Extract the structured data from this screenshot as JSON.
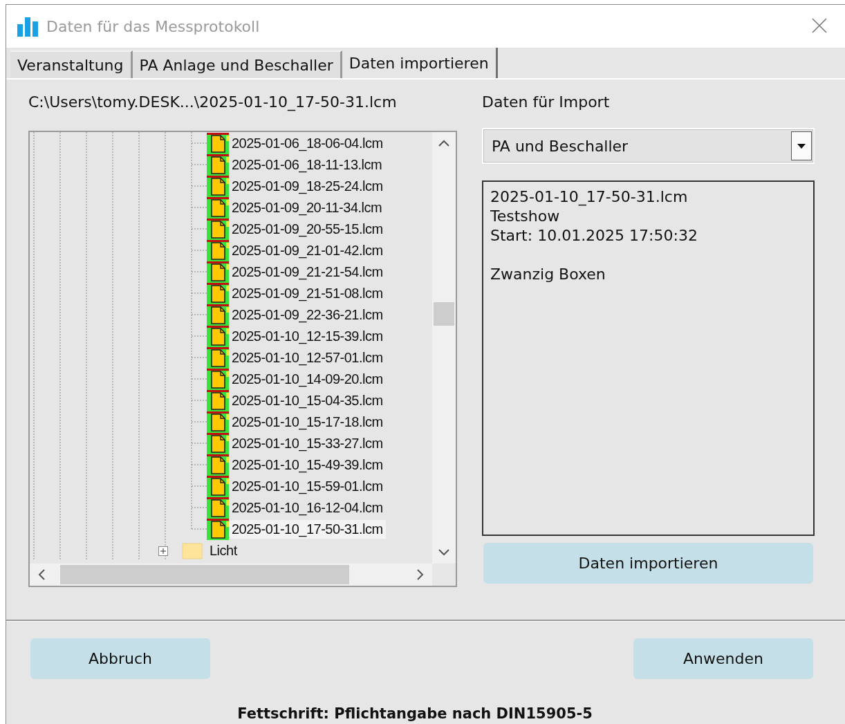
{
  "window": {
    "title": "Daten für das Messprotokoll"
  },
  "tabs": [
    {
      "label": "Veranstaltung",
      "selected": false
    },
    {
      "label": "PA Anlage und Beschaller",
      "selected": false
    },
    {
      "label": "Daten importieren",
      "selected": true
    }
  ],
  "path": "C:\\Users\\tomy.DESK...\\2025-01-10_17-50-31.lcm",
  "tree": {
    "files": [
      {
        "name": "2025-01-06_18-06-04.lcm",
        "selected": false
      },
      {
        "name": "2025-01-06_18-11-13.lcm",
        "selected": false
      },
      {
        "name": "2025-01-09_18-25-24.lcm",
        "selected": false
      },
      {
        "name": "2025-01-09_20-11-34.lcm",
        "selected": false
      },
      {
        "name": "2025-01-09_20-55-15.lcm",
        "selected": false
      },
      {
        "name": "2025-01-09_21-01-42.lcm",
        "selected": false
      },
      {
        "name": "2025-01-09_21-21-54.lcm",
        "selected": false
      },
      {
        "name": "2025-01-09_21-51-08.lcm",
        "selected": false
      },
      {
        "name": "2025-01-09_22-36-21.lcm",
        "selected": false
      },
      {
        "name": "2025-01-10_12-15-39.lcm",
        "selected": false
      },
      {
        "name": "2025-01-10_12-57-01.lcm",
        "selected": false
      },
      {
        "name": "2025-01-10_14-09-20.lcm",
        "selected": false
      },
      {
        "name": "2025-01-10_15-04-35.lcm",
        "selected": false
      },
      {
        "name": "2025-01-10_15-17-18.lcm",
        "selected": false
      },
      {
        "name": "2025-01-10_15-33-27.lcm",
        "selected": false
      },
      {
        "name": "2025-01-10_15-49-39.lcm",
        "selected": false
      },
      {
        "name": "2025-01-10_15-59-01.lcm",
        "selected": false
      },
      {
        "name": "2025-01-10_16-12-04.lcm",
        "selected": false
      },
      {
        "name": "2025-01-10_17-50-31.lcm",
        "selected": true
      }
    ],
    "folder": {
      "name": "Licht",
      "expanded": false
    }
  },
  "import": {
    "label": "Daten für Import",
    "dropdown": "PA und Beschaller",
    "info": [
      [
        "2025-01-10_17-50-31.lcm",
        "Testshow",
        "Start: 10.01.2025 17:50:32"
      ],
      [
        "Zwanzig Boxen"
      ]
    ],
    "button": "Daten importieren"
  },
  "buttons": [
    "Abbruch",
    "Anwenden"
  ],
  "footer": "Fettschrift: Pflichtangabe nach DIN15905-5"
}
